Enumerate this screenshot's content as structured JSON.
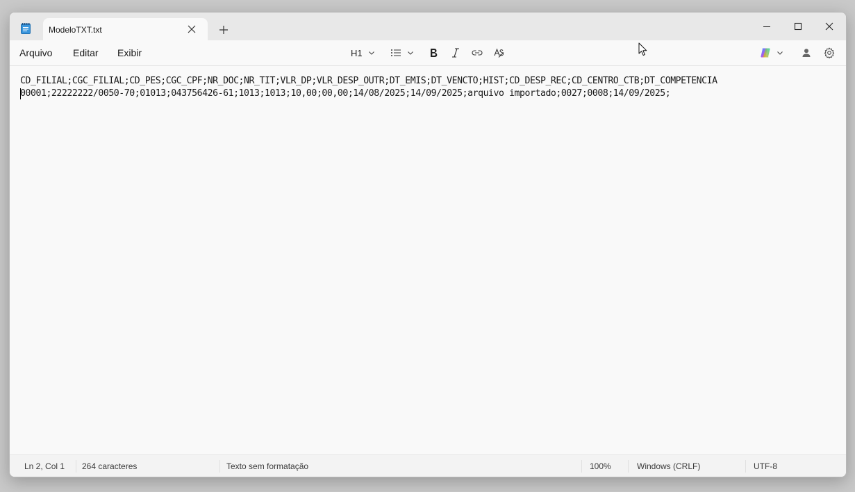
{
  "window": {
    "tab_title": "ModeloTXT.txt",
    "app_icon": "notepad-icon"
  },
  "menu": {
    "file": "Arquivo",
    "edit": "Editar",
    "view": "Exibir"
  },
  "toolbar": {
    "heading": "H1",
    "icons": [
      "list-icon",
      "bold-icon",
      "italic-icon",
      "link-icon",
      "clear-formatting-icon",
      "copilot-icon",
      "account-icon",
      "settings-icon"
    ]
  },
  "document": {
    "lines": [
      "CD_FILIAL;CGC_FILIAL;CD_PES;CGC_CPF;NR_DOC;NR_TIT;VLR_DP;VLR_DESP_OUTR;DT_EMIS;DT_VENCTO;HIST;CD_DESP_REC;CD_CENTRO_CTB;DT_COMPETENCIA",
      "00001;22222222/0050-70;01013;043756426-61;1013;1013;10,00;00,00;14/08/2025;14/09/2025;arquivo importado;0027;0008;14/09/2025;"
    ]
  },
  "status": {
    "position": "Ln 2, Col 1",
    "chars": "264 caracteres",
    "format": "Texto sem formatação",
    "zoom": "100%",
    "line_ending": "Windows (CRLF)",
    "encoding": "UTF-8"
  },
  "colors": {
    "accent": "#0067c0",
    "titlebar": "#e8e8e8",
    "background": "#f9f9f9"
  }
}
